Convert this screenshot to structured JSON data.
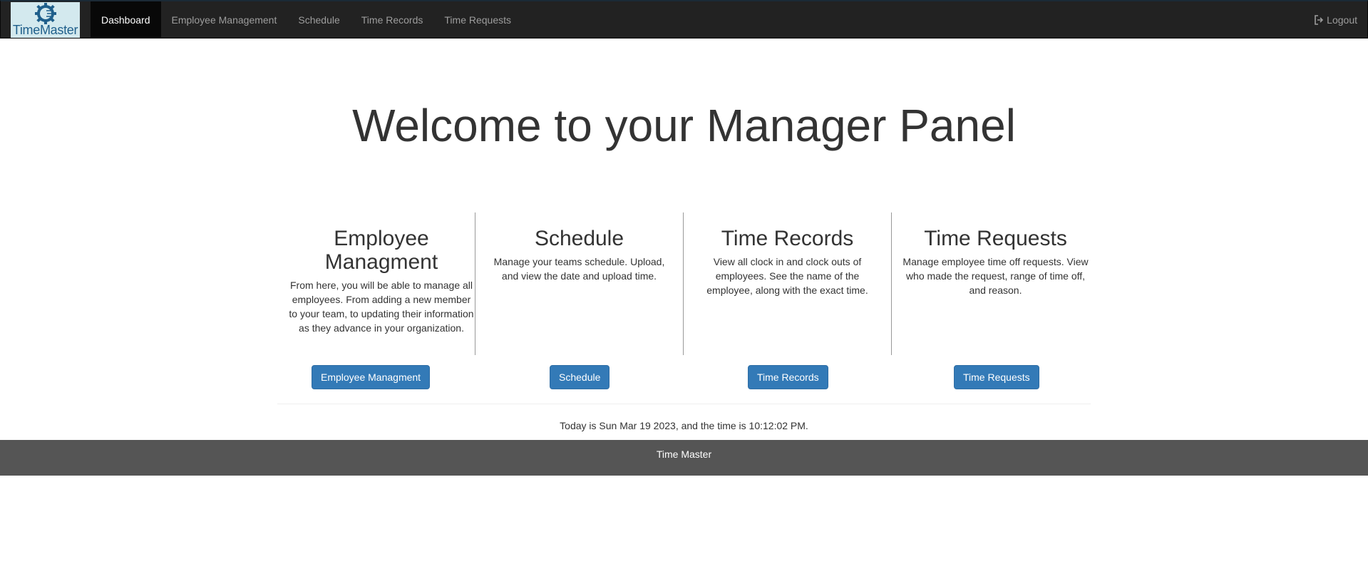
{
  "brand": {
    "logo_text": "TimeMaster",
    "logo_icon": "gear-icon",
    "logo_color": "#1f5f8b",
    "logo_bg": "#d3e9ee"
  },
  "nav": {
    "items": [
      {
        "label": "Dashboard",
        "active": true
      },
      {
        "label": "Employee Management",
        "active": false
      },
      {
        "label": "Schedule",
        "active": false
      },
      {
        "label": "Time Records",
        "active": false
      },
      {
        "label": "Time Requests",
        "active": false
      }
    ],
    "logout_label": "Logout",
    "logout_icon": "sign-out-icon"
  },
  "main": {
    "headline": "Welcome to your Manager Panel",
    "panels": [
      {
        "title_line1": "Employee",
        "title_line2": "Managment",
        "description": "From here, you will be able to manage all employees. From adding a new member to your team, to updating their information as they advance in your organization.",
        "button_label": "Employee Managment"
      },
      {
        "title_line1": "Schedule",
        "title_line2": "",
        "description": "Manage your teams schedule. Upload, and view the date and upload time.",
        "button_label": "Schedule"
      },
      {
        "title_line1": "Time Records",
        "title_line2": "",
        "description": "View all clock in and clock outs of employees. See the name of the employee, along with the exact time.",
        "button_label": "Time Records"
      },
      {
        "title_line1": "Time Requests",
        "title_line2": "",
        "description": "Manage employee time off requests. View who made the request, range of time off, and reason.",
        "button_label": "Time Requests"
      }
    ],
    "datetime_text": "Today is Sun Mar 19 2023, and the time is 10:12:02 PM."
  },
  "footer": {
    "text": "Time Master"
  },
  "colors": {
    "navbar_bg": "#222222",
    "primary_button": "#337ab7",
    "footer_bg": "#555555"
  }
}
